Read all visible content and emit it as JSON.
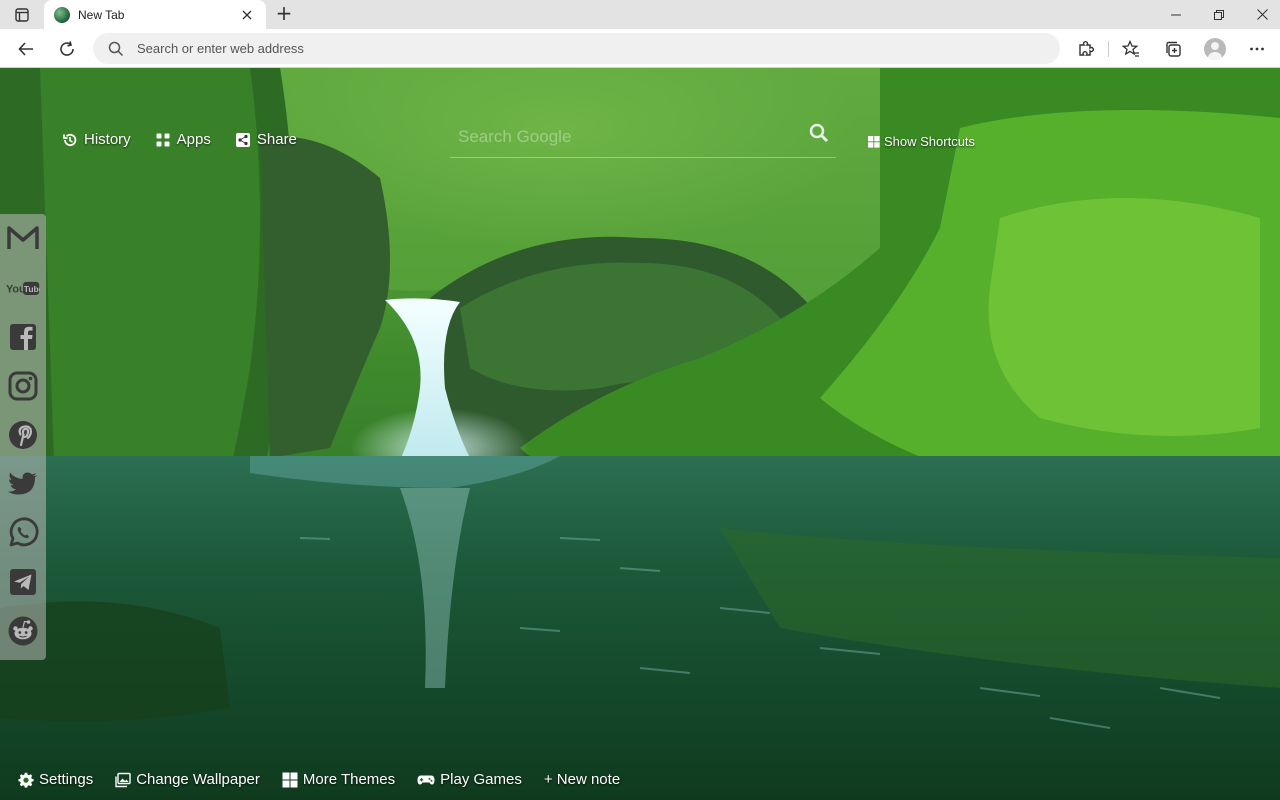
{
  "browser": {
    "tab": {
      "title": "New Tab"
    },
    "new_tab_symbol": "+",
    "address_placeholder": "Search or enter web address"
  },
  "newtab": {
    "toplinks": [
      {
        "label": "History",
        "icon": "history-icon"
      },
      {
        "label": "Apps",
        "icon": "apps-grid-icon"
      },
      {
        "label": "Share",
        "icon": "share-icon"
      }
    ],
    "search_placeholder": "Search Google",
    "show_shortcuts": "Show Shortcuts",
    "social_icons": [
      "gmail-icon",
      "youtube-icon",
      "facebook-icon",
      "instagram-icon",
      "pinterest-icon",
      "twitter-icon",
      "whatsapp-icon",
      "telegram-icon",
      "reddit-icon"
    ],
    "bottom": {
      "settings": "Settings",
      "change_wallpaper": "Change Wallpaper",
      "more_themes": "More Themes",
      "play_games": "Play Games",
      "new_note": "+ New note"
    }
  },
  "colors": {
    "social_icon": "#3a3a3a",
    "sidebar_bg": "#b9b9b9",
    "toolbar_bg": "#ffffff",
    "tabstrip_bg": "#e3e3e3"
  }
}
